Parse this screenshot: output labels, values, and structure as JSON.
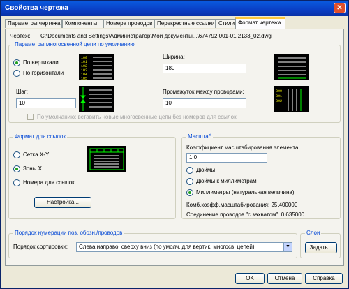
{
  "window": {
    "title": "Свойства чертежа"
  },
  "tabs": [
    {
      "label": "Параметры чертежа"
    },
    {
      "label": "Компоненты"
    },
    {
      "label": "Номера проводов"
    },
    {
      "label": "Перекрестные ссылки"
    },
    {
      "label": "Стили"
    },
    {
      "label": "Формат чертежа"
    }
  ],
  "drawing": {
    "label": "Чертеж:",
    "path": "C:\\Documents and Settings\\Администратор\\Мои документы...\\674792.001-01.2133_02.dwg"
  },
  "multiwire": {
    "title": "Параметры многосвенной цепи по умолчанию",
    "vertical": "По вертикали",
    "horizontal": "По горизонтали",
    "width_label": "Ширина:",
    "width_value": "180",
    "step_label": "Шаг:",
    "step_value": "10",
    "gap_label": "Промежуток между проводами:",
    "gap_value": "10",
    "default_checkbox": "По умолчанию: вставить новые многосвенные цепи без номеров для ссылок"
  },
  "refformat": {
    "title": "Формат для ссылок",
    "xy_grid": "Сетка X-Y",
    "x_zones": "Зоны X",
    "ref_numbers": "Номера для ссылок",
    "setup_button": "Настройка..."
  },
  "scale": {
    "title": "Масштаб",
    "factor_label": "Коэффициент масштабирования элемента:",
    "factor_value": "1.0",
    "inches": "Дюймы",
    "inches_mm": "Дюймы к миллиметрам",
    "mm": "Миллиметры (натуральная величина)",
    "combined": "Комб.коэфф.масштабирования: 25.400000",
    "connection": "Соединение проводов \"с захватом\": 0.635000"
  },
  "numbering": {
    "title": "Порядок нумерации поз. обозн./проводов",
    "sort_label": "Порядок сортировки:",
    "sort_value": "Слева направо, сверху вниз (по умолч. для вертик. многосв. цепей)"
  },
  "layers": {
    "title": "Слои",
    "set_button": "Задать..."
  },
  "footer": {
    "ok": "OK",
    "cancel": "Отмена",
    "help": "Справка"
  }
}
